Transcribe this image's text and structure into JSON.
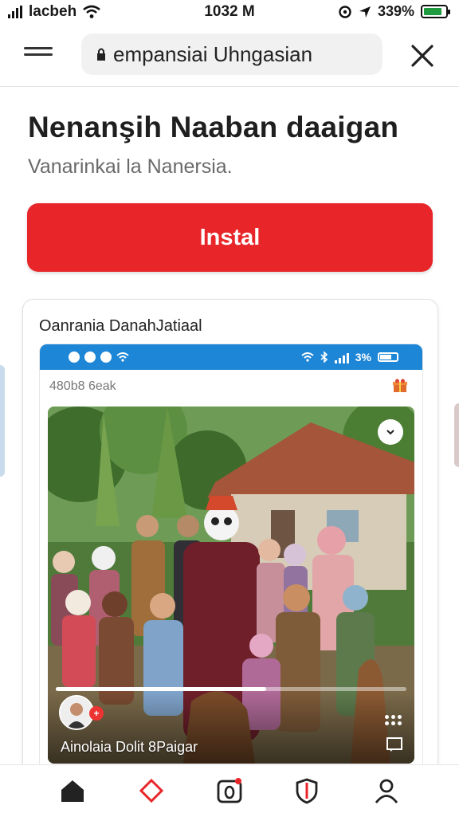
{
  "status_bar": {
    "carrier": "lacbeh",
    "time": "1032 M",
    "battery_percent": "339%"
  },
  "app_bar": {
    "url_text": "empansiai Uhngasian",
    "menu_icon": "menu-icon",
    "close_icon": "close-icon"
  },
  "page": {
    "title": "Nenanşih Naaban daaigan",
    "subtitle": "Vanarinkai la Nanersia.",
    "install_label": "Instal",
    "card": {
      "title": "Oanrania DanahJatiaal",
      "preview": {
        "status_text": "3%",
        "header_text": "480b8 6eak",
        "caption": "Ainolaia Dolit 8Paigar",
        "progress": 0.6
      }
    }
  },
  "bottom_nav": {
    "items": [
      "home-icon",
      "diamond-icon",
      "camera-icon",
      "shield-icon",
      "profile-icon"
    ],
    "active": "home-icon"
  },
  "colors": {
    "accent": "#e8262a",
    "preview_status": "#1e86d6"
  }
}
